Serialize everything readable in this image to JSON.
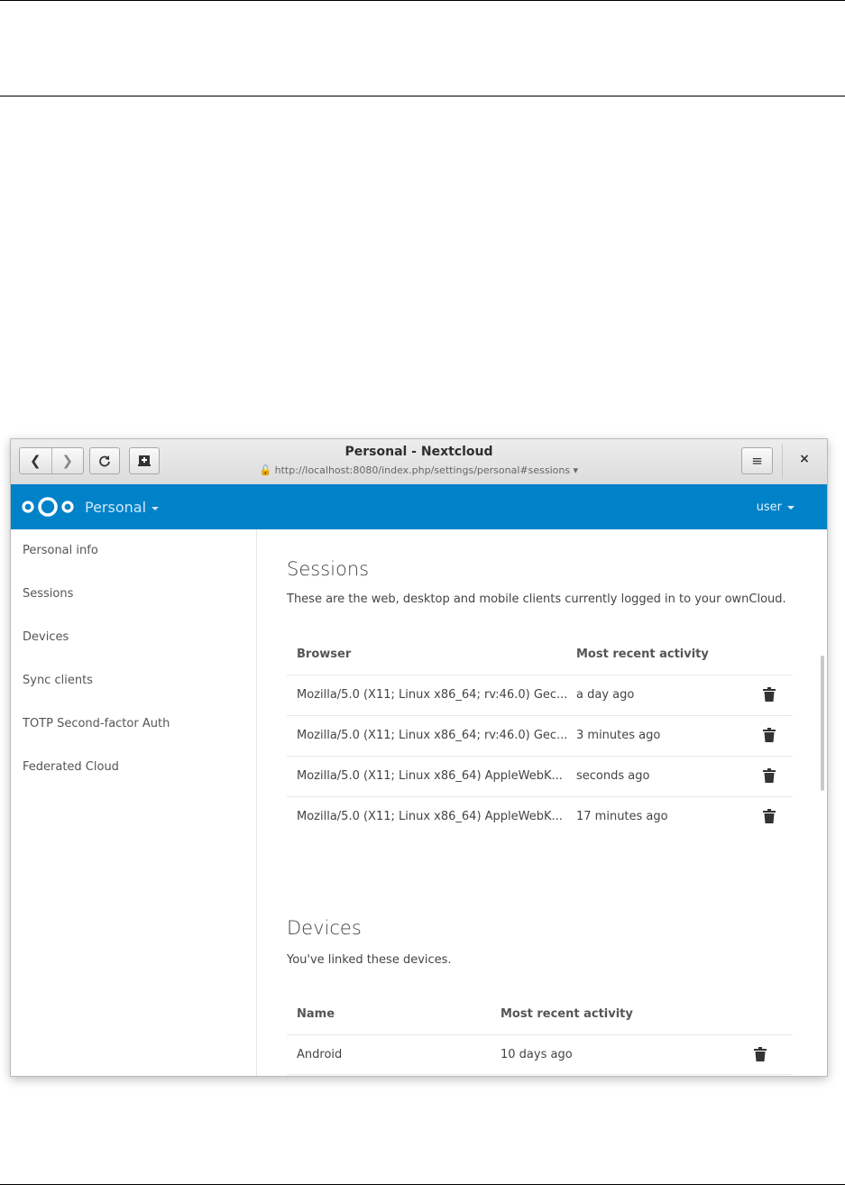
{
  "window": {
    "title": "Personal - Nextcloud",
    "url": "http://localhost:8080/index.php/settings/personal#sessions ▾",
    "close_label": "×",
    "menu_label": "≡"
  },
  "header": {
    "app_name": "Personal",
    "user": "user",
    "brand_color": "#0082c9"
  },
  "sidebar": {
    "items": [
      {
        "label": "Personal info"
      },
      {
        "label": "Sessions"
      },
      {
        "label": "Devices"
      },
      {
        "label": "Sync clients"
      },
      {
        "label": "TOTP Second-factor Auth"
      },
      {
        "label": "Federated Cloud"
      }
    ]
  },
  "sessions": {
    "title": "Sessions",
    "description": "These are the web, desktop and mobile clients currently logged in to your ownCloud.",
    "col_browser": "Browser",
    "col_activity": "Most recent activity",
    "rows": [
      {
        "browser": "Mozilla/5.0 (X11; Linux x86_64; rv:46.0) Gec...",
        "activity": "a day ago"
      },
      {
        "browser": "Mozilla/5.0 (X11; Linux x86_64; rv:46.0) Gec...",
        "activity": "3 minutes ago"
      },
      {
        "browser": "Mozilla/5.0 (X11; Linux x86_64) AppleWebK...",
        "activity": "seconds ago"
      },
      {
        "browser": "Mozilla/5.0 (X11; Linux x86_64) AppleWebK...",
        "activity": "17 minutes ago"
      }
    ]
  },
  "devices": {
    "title": "Devices",
    "description": "You've linked these devices.",
    "col_name": "Name",
    "col_activity": "Most recent activity",
    "rows": [
      {
        "name": "Android",
        "activity": "10 days ago"
      }
    ]
  }
}
